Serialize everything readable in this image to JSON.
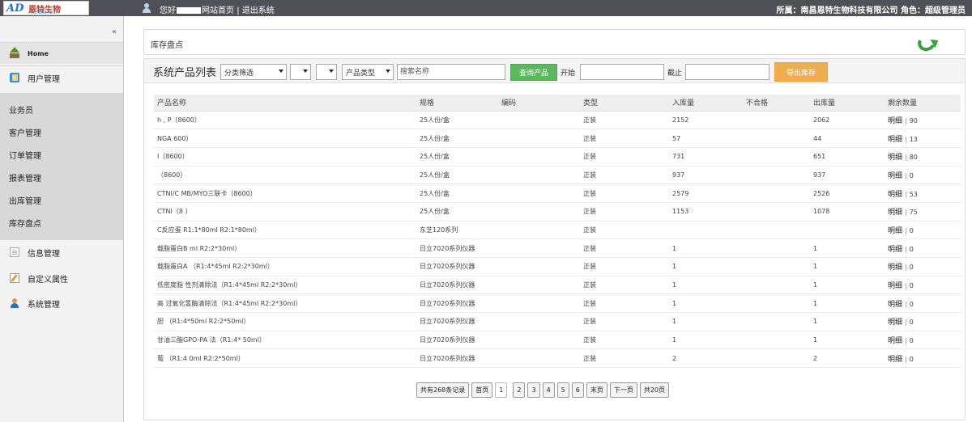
{
  "app": {
    "logo_mark": "AD",
    "logo_cn": "恩特生物",
    "logo_en": "ANDBIOTECH"
  },
  "topbar": {
    "greeting_prefix": "您好",
    "home_link": "网站首页",
    "separator": "|",
    "logout_link": "退出系统",
    "company_label": "所属：",
    "company": "南昌恩特生物科技有限公司",
    "role_label": "角色：",
    "role": "超级管理员"
  },
  "sidebar": {
    "collapse": "«",
    "home": "Home",
    "user_mgmt": "用户管理",
    "sub_items": [
      "业务员",
      "客户管理",
      "订单管理",
      "报表管理",
      "出库管理",
      "库存盘点"
    ],
    "info_mgmt": "信息管理",
    "custom_attr": "自定义属性",
    "sys_mgmt": "系统管理"
  },
  "breadcrumb": "库存盘点",
  "toolbar": {
    "title": "系统产品列表",
    "category_filter": "分类筛选",
    "product_type": "产品类型",
    "search_placeholder": "搜索名称",
    "query_button": "查询产品",
    "start_label": "开始",
    "end_label": "截止",
    "export_button": "导出库存"
  },
  "table": {
    "headers": [
      "产品名称",
      "规格",
      "编码",
      "类型",
      "入库量",
      "不合格",
      "出库量",
      "剩余数量"
    ],
    "detail_label": "明细",
    "rows": [
      {
        "name": "h ,     P（8600）",
        "spec": "25人份/盒",
        "code": "",
        "type": "正装",
        "in": "2152",
        "bad": "",
        "out": "2062",
        "remain": "90"
      },
      {
        "name": "NGA  600）",
        "spec": "25人份/盒",
        "code": "",
        "type": "正装",
        "in": "57",
        "bad": "",
        "out": "44",
        "remain": "13"
      },
      {
        "name": "  I（8600）",
        "spec": "25人份/盒",
        "code": "",
        "type": "正装",
        "in": "731",
        "bad": "",
        "out": "651",
        "remain": "80"
      },
      {
        "name": "  （8600）",
        "spec": "25人份/盒",
        "code": "",
        "type": "正装",
        "in": "937",
        "bad": "",
        "out": "937",
        "remain": "0"
      },
      {
        "name": "CTNI/C  MB/MYO三联卡（8600）",
        "spec": "25人份/盒",
        "code": "",
        "type": "正装",
        "in": "2579",
        "bad": "",
        "out": "2526",
        "remain": "53"
      },
      {
        "name": "CTNI（8 ）",
        "spec": "25人份/盒",
        "code": "",
        "type": "正装",
        "in": "1153",
        "bad": "",
        "out": "1078",
        "remain": "75"
      },
      {
        "name": "C反应蛋  R1:1*80ml R2:1*80ml）",
        "spec": "东芝120系列",
        "code": "",
        "type": "正装",
        "in": "",
        "bad": "",
        "out": "",
        "remain": "0"
      },
      {
        "name": "载脂蛋白B  ml R2:2*30ml）",
        "spec": "日立7020系列仪器",
        "code": "",
        "type": "正装",
        "in": "1",
        "bad": "",
        "out": "1",
        "remain": "0"
      },
      {
        "name": "载脂蛋白A （R1:4*45ml R2:2*30ml）",
        "spec": "日立7020系列仪器",
        "code": "",
        "type": "正装",
        "in": "1",
        "bad": "",
        "out": "1",
        "remain": "0"
      },
      {
        "name": "低密度脂  性剂清除法（R1:4*45ml R2:2*30ml）",
        "spec": "日立7020系列仪器",
        "code": "",
        "type": "正装",
        "in": "1",
        "bad": "",
        "out": "1",
        "remain": "0"
      },
      {
        "name": "高  过氧化氢酶清除法（R1:4*45ml R2:2*30ml）",
        "spec": "日立7020系列仪器",
        "code": "",
        "type": "正装",
        "in": "1",
        "bad": "",
        "out": "1",
        "remain": "0"
      },
      {
        "name": "胆  （R1:4*50ml R2:2*50ml）",
        "spec": "日立7020系列仪器",
        "code": "",
        "type": "正装",
        "in": "1",
        "bad": "",
        "out": "1",
        "remain": "0"
      },
      {
        "name": "甘油三酯GPO-PA 法（R1:4*  50ml）",
        "spec": "日立7020系列仪器",
        "code": "",
        "type": "正装",
        "in": "1",
        "bad": "",
        "out": "1",
        "remain": "0"
      },
      {
        "name": "葡  （R1:4 0ml R2:2*50ml）",
        "spec": "日立7020系列仪器",
        "code": "",
        "type": "正装",
        "in": "2",
        "bad": "",
        "out": "2",
        "remain": "0"
      }
    ]
  },
  "pager": {
    "total": "共有268条记录",
    "first": "首页",
    "pages": [
      "1",
      "2",
      "3",
      "4",
      "5",
      "6"
    ],
    "last": "末页",
    "next": "下一页",
    "count": "共20页"
  }
}
